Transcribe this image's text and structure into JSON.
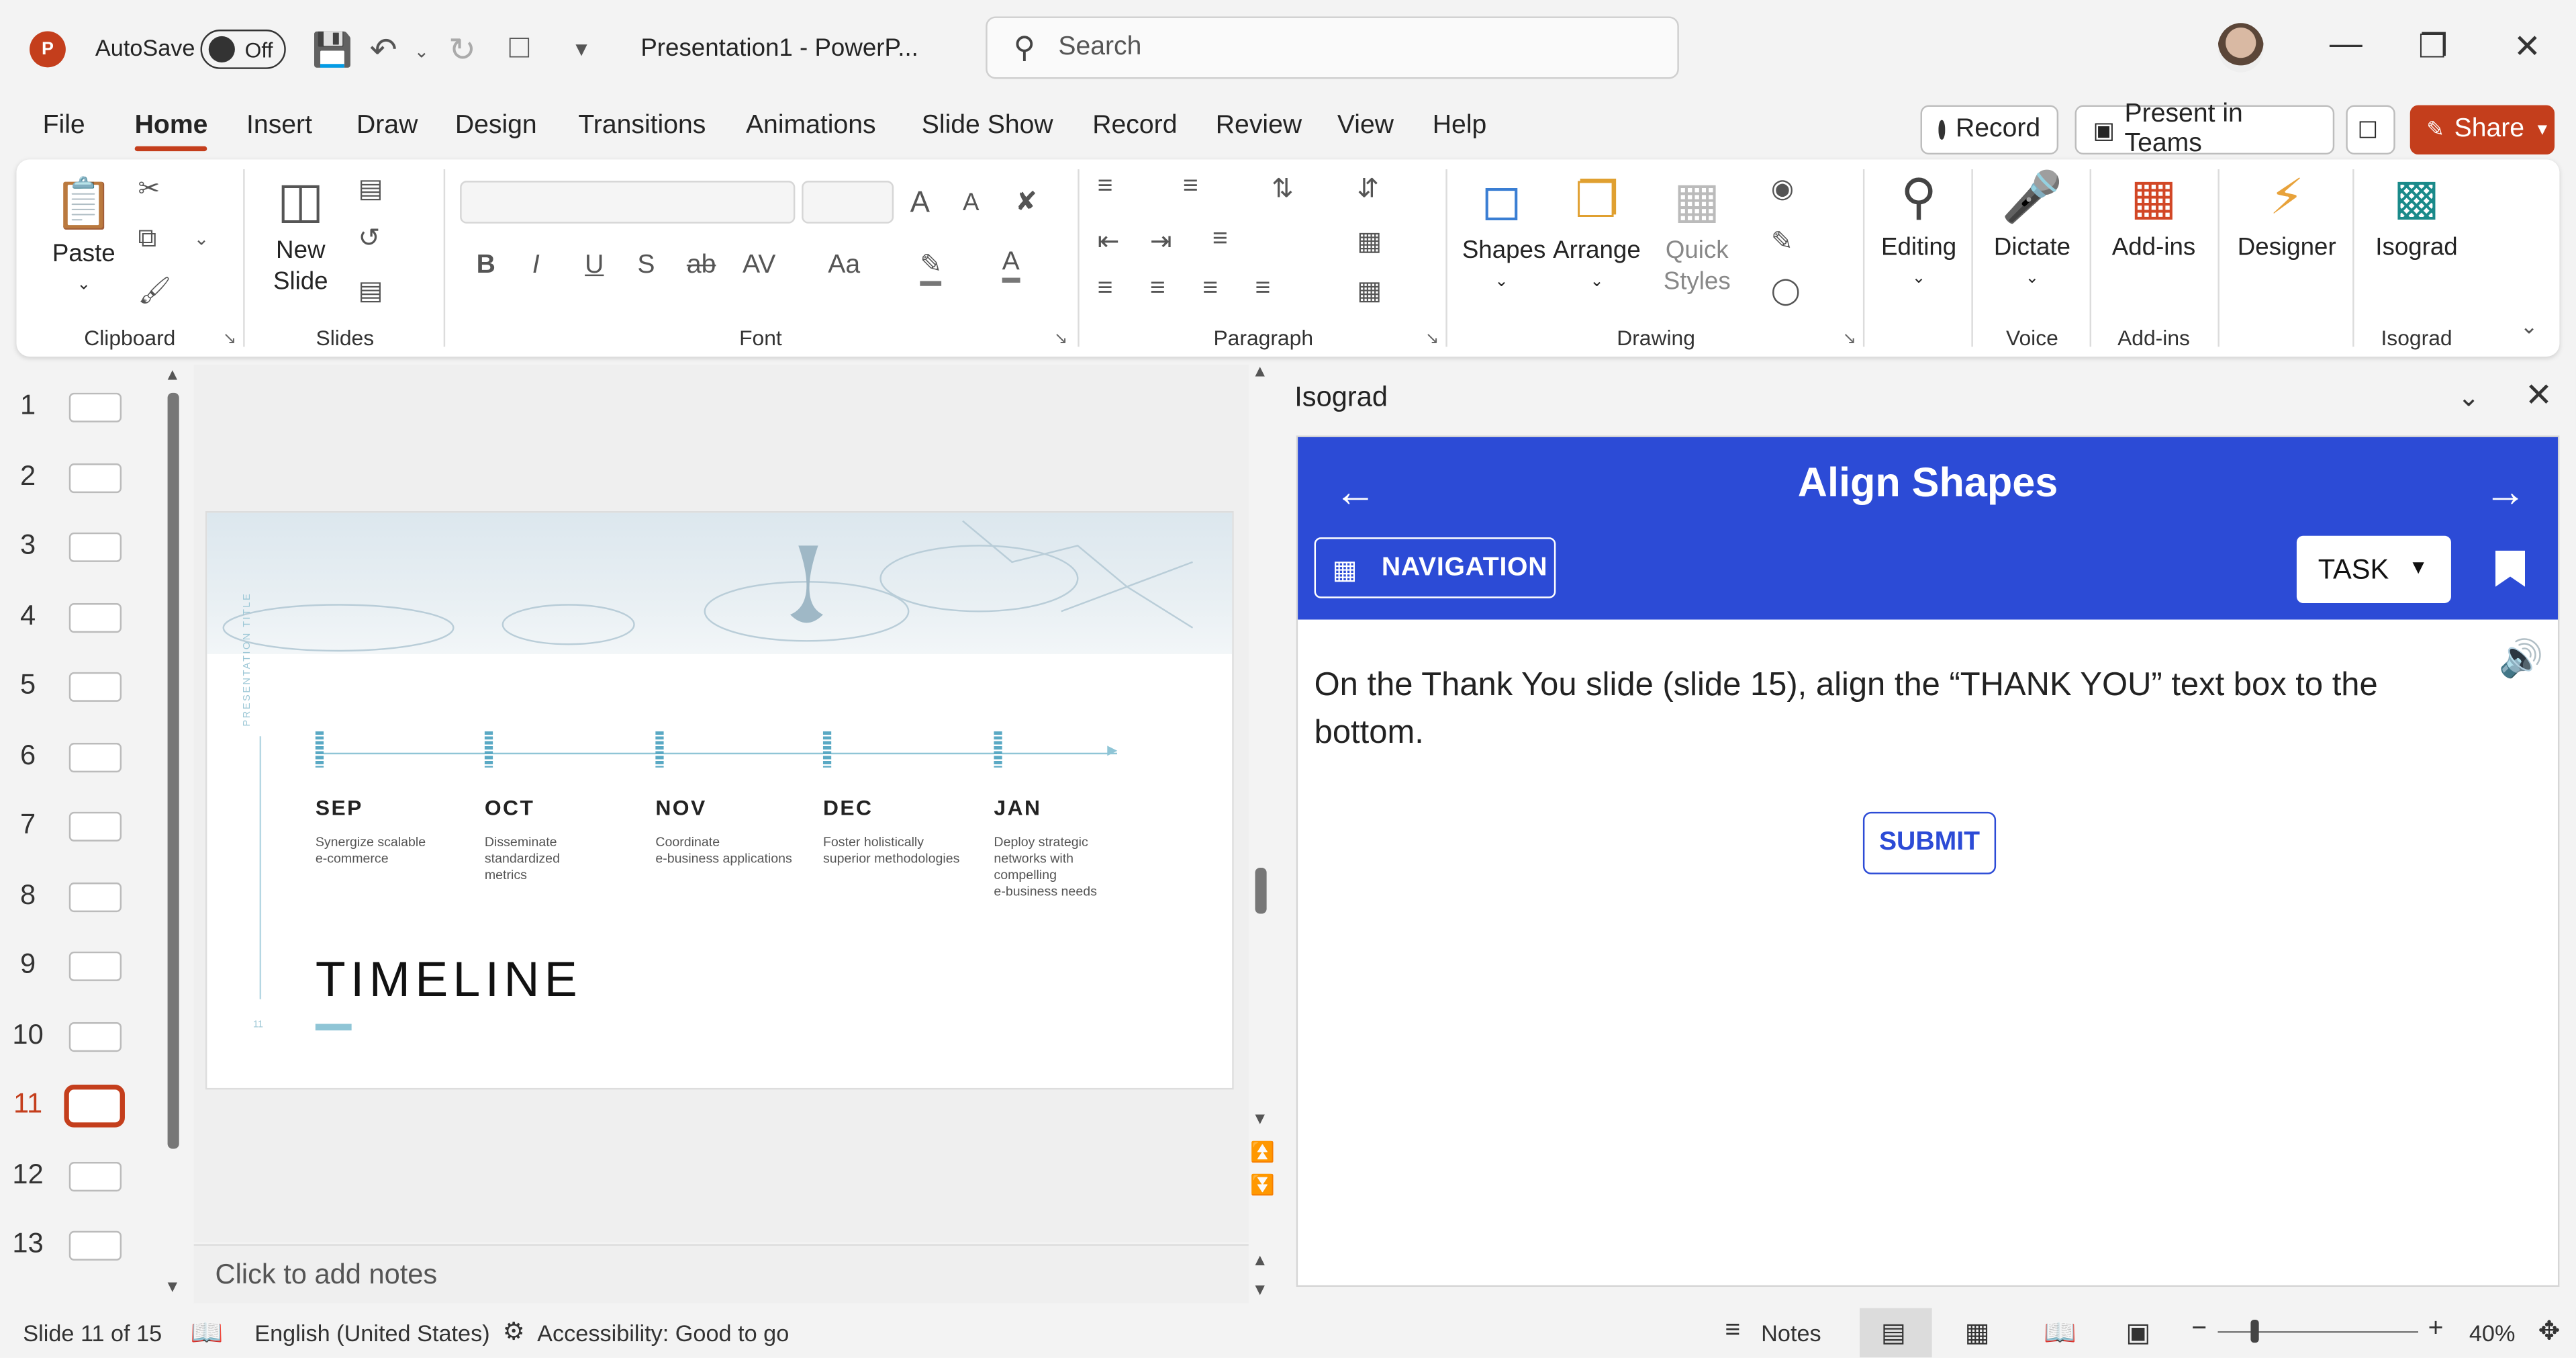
{
  "titlebar": {
    "app_icon": "P",
    "autosave_label": "AutoSave",
    "autosave_state": "Off",
    "doc_title": "Presentation1  -  PowerP...",
    "search_placeholder": "Search"
  },
  "menu": {
    "tabs": [
      "File",
      "Home",
      "Insert",
      "Draw",
      "Design",
      "Transitions",
      "Animations",
      "Slide Show",
      "Record",
      "Review",
      "View",
      "Help"
    ],
    "active_tab": "Home",
    "record_label": "Record",
    "present_label": "Present in Teams",
    "share_label": "Share"
  },
  "ribbon": {
    "clipboard": {
      "paste": "Paste",
      "label": "Clipboard"
    },
    "slides": {
      "new_slide_1": "New",
      "new_slide_2": "Slide",
      "label": "Slides"
    },
    "font": {
      "label": "Font",
      "bold": "B",
      "italic": "I",
      "underline": "U",
      "shadow": "S",
      "strike": "ab",
      "spacing": "AV",
      "case": "Aa",
      "grow": "A",
      "shrink": "A"
    },
    "paragraph": {
      "label": "Paragraph"
    },
    "drawing": {
      "shapes": "Shapes",
      "arrange": "Arrange",
      "quick_1": "Quick",
      "quick_2": "Styles",
      "label": "Drawing"
    },
    "editing": {
      "label": "Editing"
    },
    "voice": {
      "dictate": "Dictate",
      "label": "Voice"
    },
    "addins": {
      "button": "Add-ins",
      "label": "Add-ins"
    },
    "designer": {
      "button": "Designer"
    },
    "isograd": {
      "button": "Isograd",
      "label": "Isograd"
    }
  },
  "thumbnails": {
    "numbers": [
      "1",
      "2",
      "3",
      "4",
      "5",
      "6",
      "7",
      "8",
      "9",
      "10",
      "11",
      "12",
      "13"
    ],
    "selected": "11"
  },
  "slide": {
    "vertical_title": "PRESENTATION TITLE",
    "months": [
      "SEP",
      "OCT",
      "NOV",
      "DEC",
      "JAN"
    ],
    "descriptions": [
      "Synergize scalable\ne-commerce",
      "Disseminate\nstandardized\nmetrics",
      "Coordinate\ne-business applications",
      "Foster holistically\nsuperior methodologies",
      "Deploy strategic\nnetworks with\ncompelling\ne-business needs"
    ],
    "title": "TIMELINE",
    "page_number": "11"
  },
  "notes": {
    "placeholder": "Click to add notes"
  },
  "pane": {
    "title": "Isograd",
    "lesson_title": "Align Shapes",
    "navigation_label": "NAVIGATION",
    "task_label": "TASK",
    "instruction": "On the Thank You slide (slide 15), align the “THANK YOU” text box to the bottom.",
    "submit_label": "SUBMIT",
    "accent_color": "#2c4bd6"
  },
  "status": {
    "slide_info": "Slide 11 of 15",
    "language": "English (United States)",
    "accessibility": "Accessibility: Good to go",
    "notes_label": "Notes",
    "zoom": "40%"
  }
}
